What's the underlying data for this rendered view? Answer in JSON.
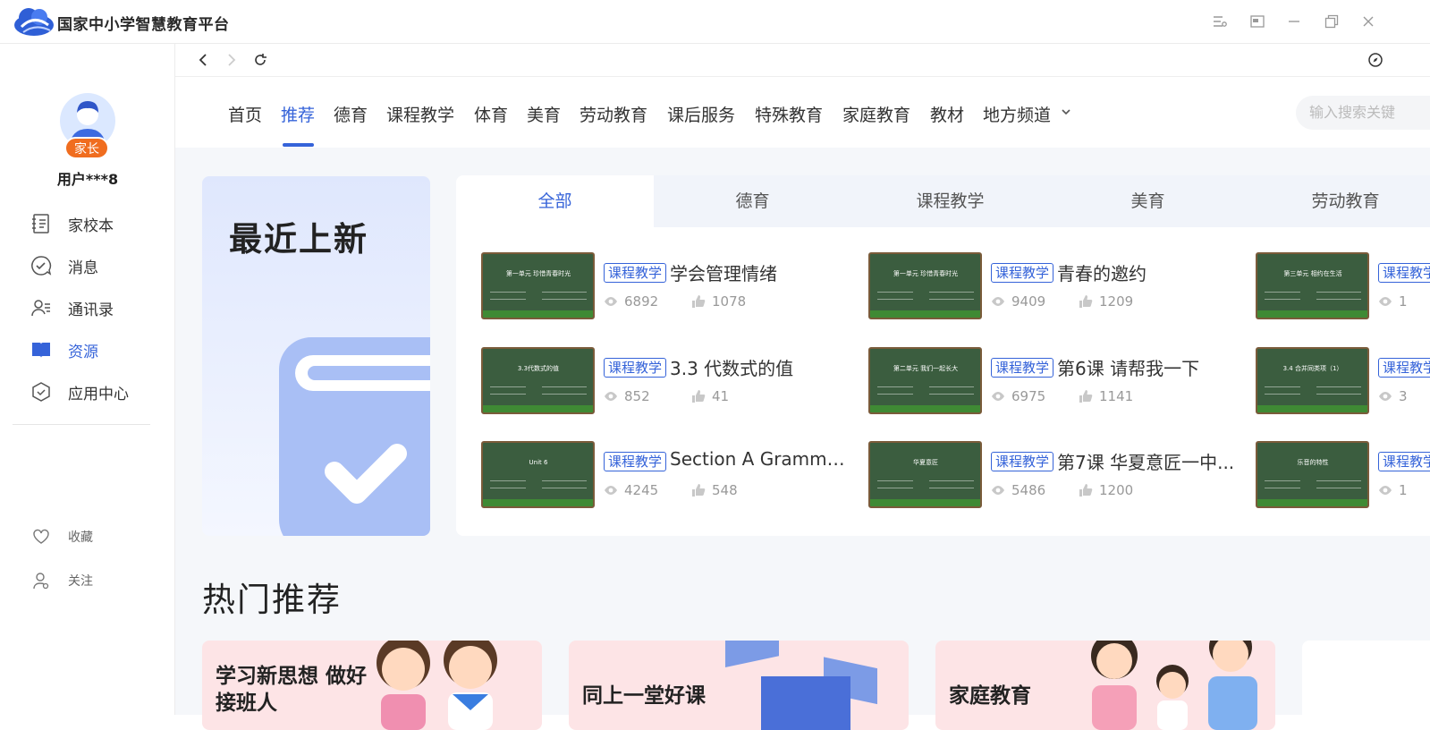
{
  "app": {
    "title": "国家中小学智慧教育平台"
  },
  "user": {
    "role": "家长",
    "name": "用户***8"
  },
  "sidebar": {
    "items": [
      {
        "label": "家校本",
        "icon": "notebook-icon"
      },
      {
        "label": "消息",
        "icon": "message-check-icon"
      },
      {
        "label": "通讯录",
        "icon": "contacts-icon"
      },
      {
        "label": "资源",
        "icon": "book-icon",
        "active": true
      },
      {
        "label": "应用中心",
        "icon": "app-center-icon"
      }
    ],
    "bottom": [
      {
        "label": "收藏",
        "icon": "heart-icon"
      },
      {
        "label": "关注",
        "icon": "follow-user-icon"
      }
    ]
  },
  "topnav": {
    "tabs": [
      "首页",
      "推荐",
      "德育",
      "课程教学",
      "体育",
      "美育",
      "劳动教育",
      "课后服务",
      "特殊教育",
      "家庭教育",
      "教材",
      "地方频道"
    ],
    "active": "推荐",
    "search_placeholder": "输入搜索关键"
  },
  "recent": {
    "title": "最近上新",
    "categories": [
      "全部",
      "德育",
      "课程教学",
      "美育",
      "劳动教育"
    ],
    "active_category": "全部",
    "items": [
      {
        "tag": "课程教学",
        "title": "学会管理情绪",
        "views": "6892",
        "likes": "1078",
        "thumb": "第一单元 珍惜青春时光"
      },
      {
        "tag": "课程教学",
        "title": "青春的邀约",
        "views": "9409",
        "likes": "1209",
        "thumb": "第一单元 珍惜青春时光"
      },
      {
        "tag": "课程教学",
        "title": "",
        "views": "1",
        "likes": "",
        "thumb": "第三单元 相约在生活"
      },
      {
        "tag": "课程教学",
        "title": "3.3 代数式的值",
        "views": "852",
        "likes": "41",
        "thumb": "3.3代数式的值"
      },
      {
        "tag": "课程教学",
        "title": "第6课 请帮我一下",
        "views": "6975",
        "likes": "1141",
        "thumb": "第二单元 我们一起长大"
      },
      {
        "tag": "课程教学",
        "title": "",
        "views": "3",
        "likes": "",
        "thumb": "3.4 合并同类项（1）"
      },
      {
        "tag": "课程教学",
        "title": "Section A Grammar...",
        "views": "4245",
        "likes": "548",
        "thumb": "Unit 6"
      },
      {
        "tag": "课程教学",
        "title": "第7课 华夏意匠一中...",
        "views": "5486",
        "likes": "1200",
        "thumb": "华夏意匠"
      },
      {
        "tag": "课程教学",
        "title": "",
        "views": "1",
        "likes": "",
        "thumb": "乐音的特性"
      }
    ]
  },
  "hot": {
    "title": "热门推荐",
    "cards": [
      "学习新思想 做好接班人",
      "同上一堂好课",
      "家庭教育"
    ]
  },
  "colors": {
    "accent": "#3563d9",
    "badge": "#f06d1f",
    "main_bg": "#f5f7fa",
    "card_pink": "#fde4e6",
    "chalkboard": "#3b5d3f"
  }
}
